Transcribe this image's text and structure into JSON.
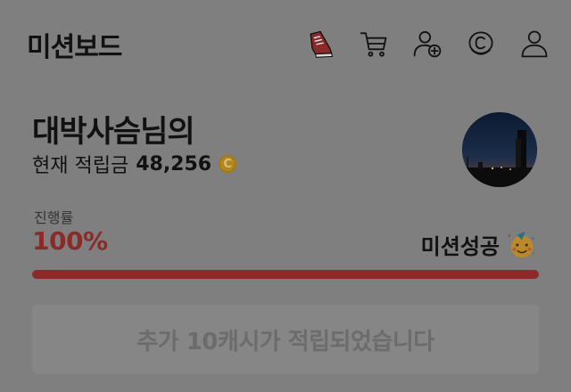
{
  "header": {
    "title": "미션보드",
    "icons": [
      "sneaker-icon",
      "cart-icon",
      "add-user-icon",
      "cash-coin-icon",
      "profile-icon"
    ]
  },
  "profile": {
    "user_name": "대박사슴님의",
    "points_label": "현재 적립금",
    "points_value": "48,256",
    "coin_symbol": "C"
  },
  "progress": {
    "label": "진행률",
    "percent_text": "100%",
    "fraction": 1.0,
    "status_text": "미션성공",
    "bar_color": "#8c2a2a"
  },
  "reward_button": {
    "label": "추가 10캐시가 적립되었습니다"
  }
}
